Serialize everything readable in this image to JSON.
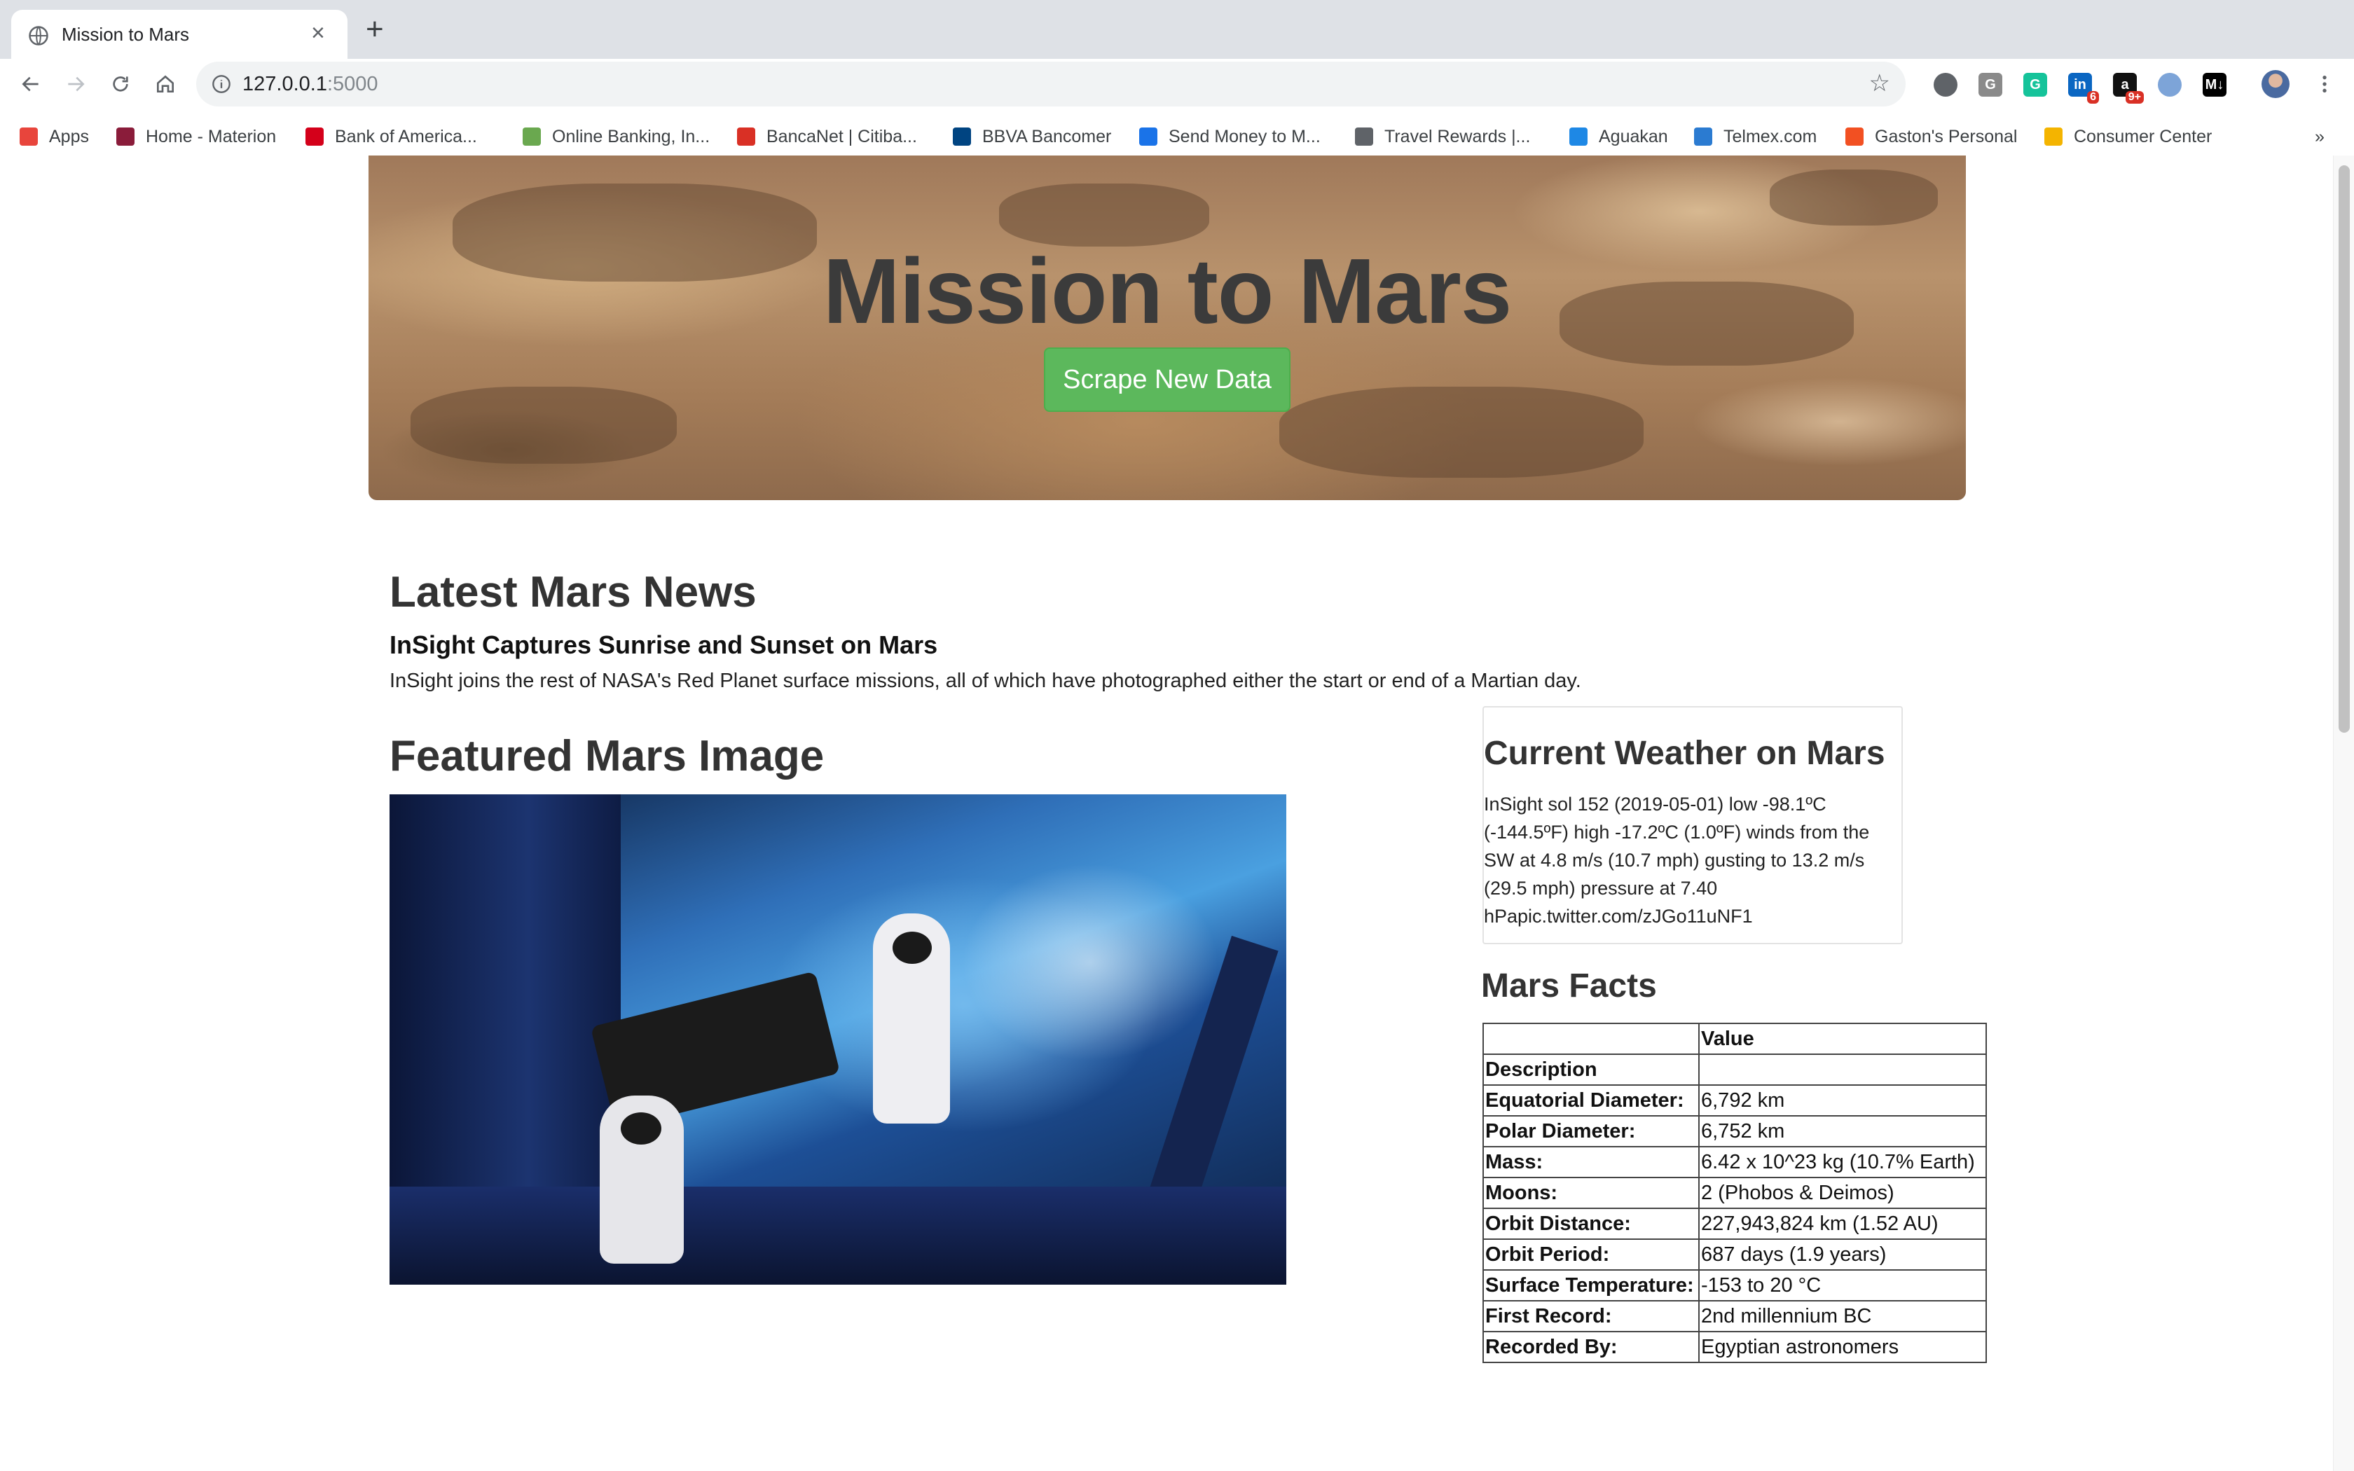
{
  "tab": {
    "title": "Mission to Mars",
    "close": "×",
    "new_tab": "+"
  },
  "address_bar": {
    "host": "127.0.0.1",
    "port": ":5000"
  },
  "bookmarks": [
    {
      "label": "Apps",
      "color": "#e8453c"
    },
    {
      "label": "Home - Materion",
      "color": "#8a1c3a"
    },
    {
      "label": "Bank of America...",
      "color": "#d4001a"
    },
    {
      "label": "Online Banking, In...",
      "color": "#6aa84f"
    },
    {
      "label": "BancaNet | Citiba...",
      "color": "#d93025"
    },
    {
      "label": "BBVA Bancomer",
      "color": "#004481"
    },
    {
      "label": "Send Money to M...",
      "color": "#1a73e8"
    },
    {
      "label": "Travel Rewards |...",
      "color": "#5f6368"
    },
    {
      "label": "Aguakan",
      "color": "#1e88e5"
    },
    {
      "label": "Telmex.com",
      "color": "#2b7bd1"
    },
    {
      "label": "Gaston's Personal",
      "color": "#f25022"
    },
    {
      "label": "Consumer Center",
      "color": "#f4b400"
    }
  ],
  "bookmarks_overflow": "»",
  "extensions": [
    {
      "name": "ext-circle-icon",
      "text": "",
      "color": "#5f6368"
    },
    {
      "name": "ext-g-icon",
      "text": "G",
      "color": "#8a8a8a"
    },
    {
      "name": "grammarly-icon",
      "text": "G",
      "color": "#15c39a"
    },
    {
      "name": "linkedin-icon",
      "text": "in",
      "color": "#0a66c2",
      "badge": "6"
    },
    {
      "name": "amazon-icon",
      "text": "a",
      "color": "#111111",
      "badge": "9+"
    },
    {
      "name": "ext-blue-icon",
      "text": "",
      "color": "#7da4d8"
    },
    {
      "name": "medium-icon",
      "text": "M↓",
      "color": "#000000"
    }
  ],
  "jumbotron": {
    "title": "Mission to Mars",
    "button": "Scrape New Data"
  },
  "news": {
    "heading": "Latest Mars News",
    "title": "InSight Captures Sunrise and Sunset on Mars",
    "paragraph": "InSight joins the rest of NASA's Red Planet surface missions, all of which have photographed either the start or end of a Martian day."
  },
  "featured": {
    "heading": "Featured Mars Image"
  },
  "weather": {
    "heading": "Current Weather on Mars",
    "text": "InSight sol 152 (2019-05-01) low -98.1ºC (-144.5ºF) high -17.2ºC (1.0ºF) winds from the SW at 4.8 m/s (10.7 mph) gusting to 13.2 m/s (29.5 mph) pressure at 7.40 hPapic.twitter.com/zJGo11uNF1"
  },
  "facts": {
    "heading": "Mars Facts",
    "col_header": "Value",
    "index_label": "Description",
    "rows": [
      {
        "label": "Equatorial Diameter:",
        "value": "6,792 km"
      },
      {
        "label": "Polar Diameter:",
        "value": "6,752 km"
      },
      {
        "label": "Mass:",
        "value": "6.42 x 10^23 kg (10.7% Earth)"
      },
      {
        "label": "Moons:",
        "value": "2 (Phobos & Deimos)"
      },
      {
        "label": "Orbit Distance:",
        "value": "227,943,824 km (1.52 AU)"
      },
      {
        "label": "Orbit Period:",
        "value": "687 days (1.9 years)"
      },
      {
        "label": "Surface Temperature:",
        "value": "-153 to 20 °C"
      },
      {
        "label": "First Record:",
        "value": "2nd millennium BC"
      },
      {
        "label": "Recorded By:",
        "value": "Egyptian astronomers"
      }
    ]
  }
}
